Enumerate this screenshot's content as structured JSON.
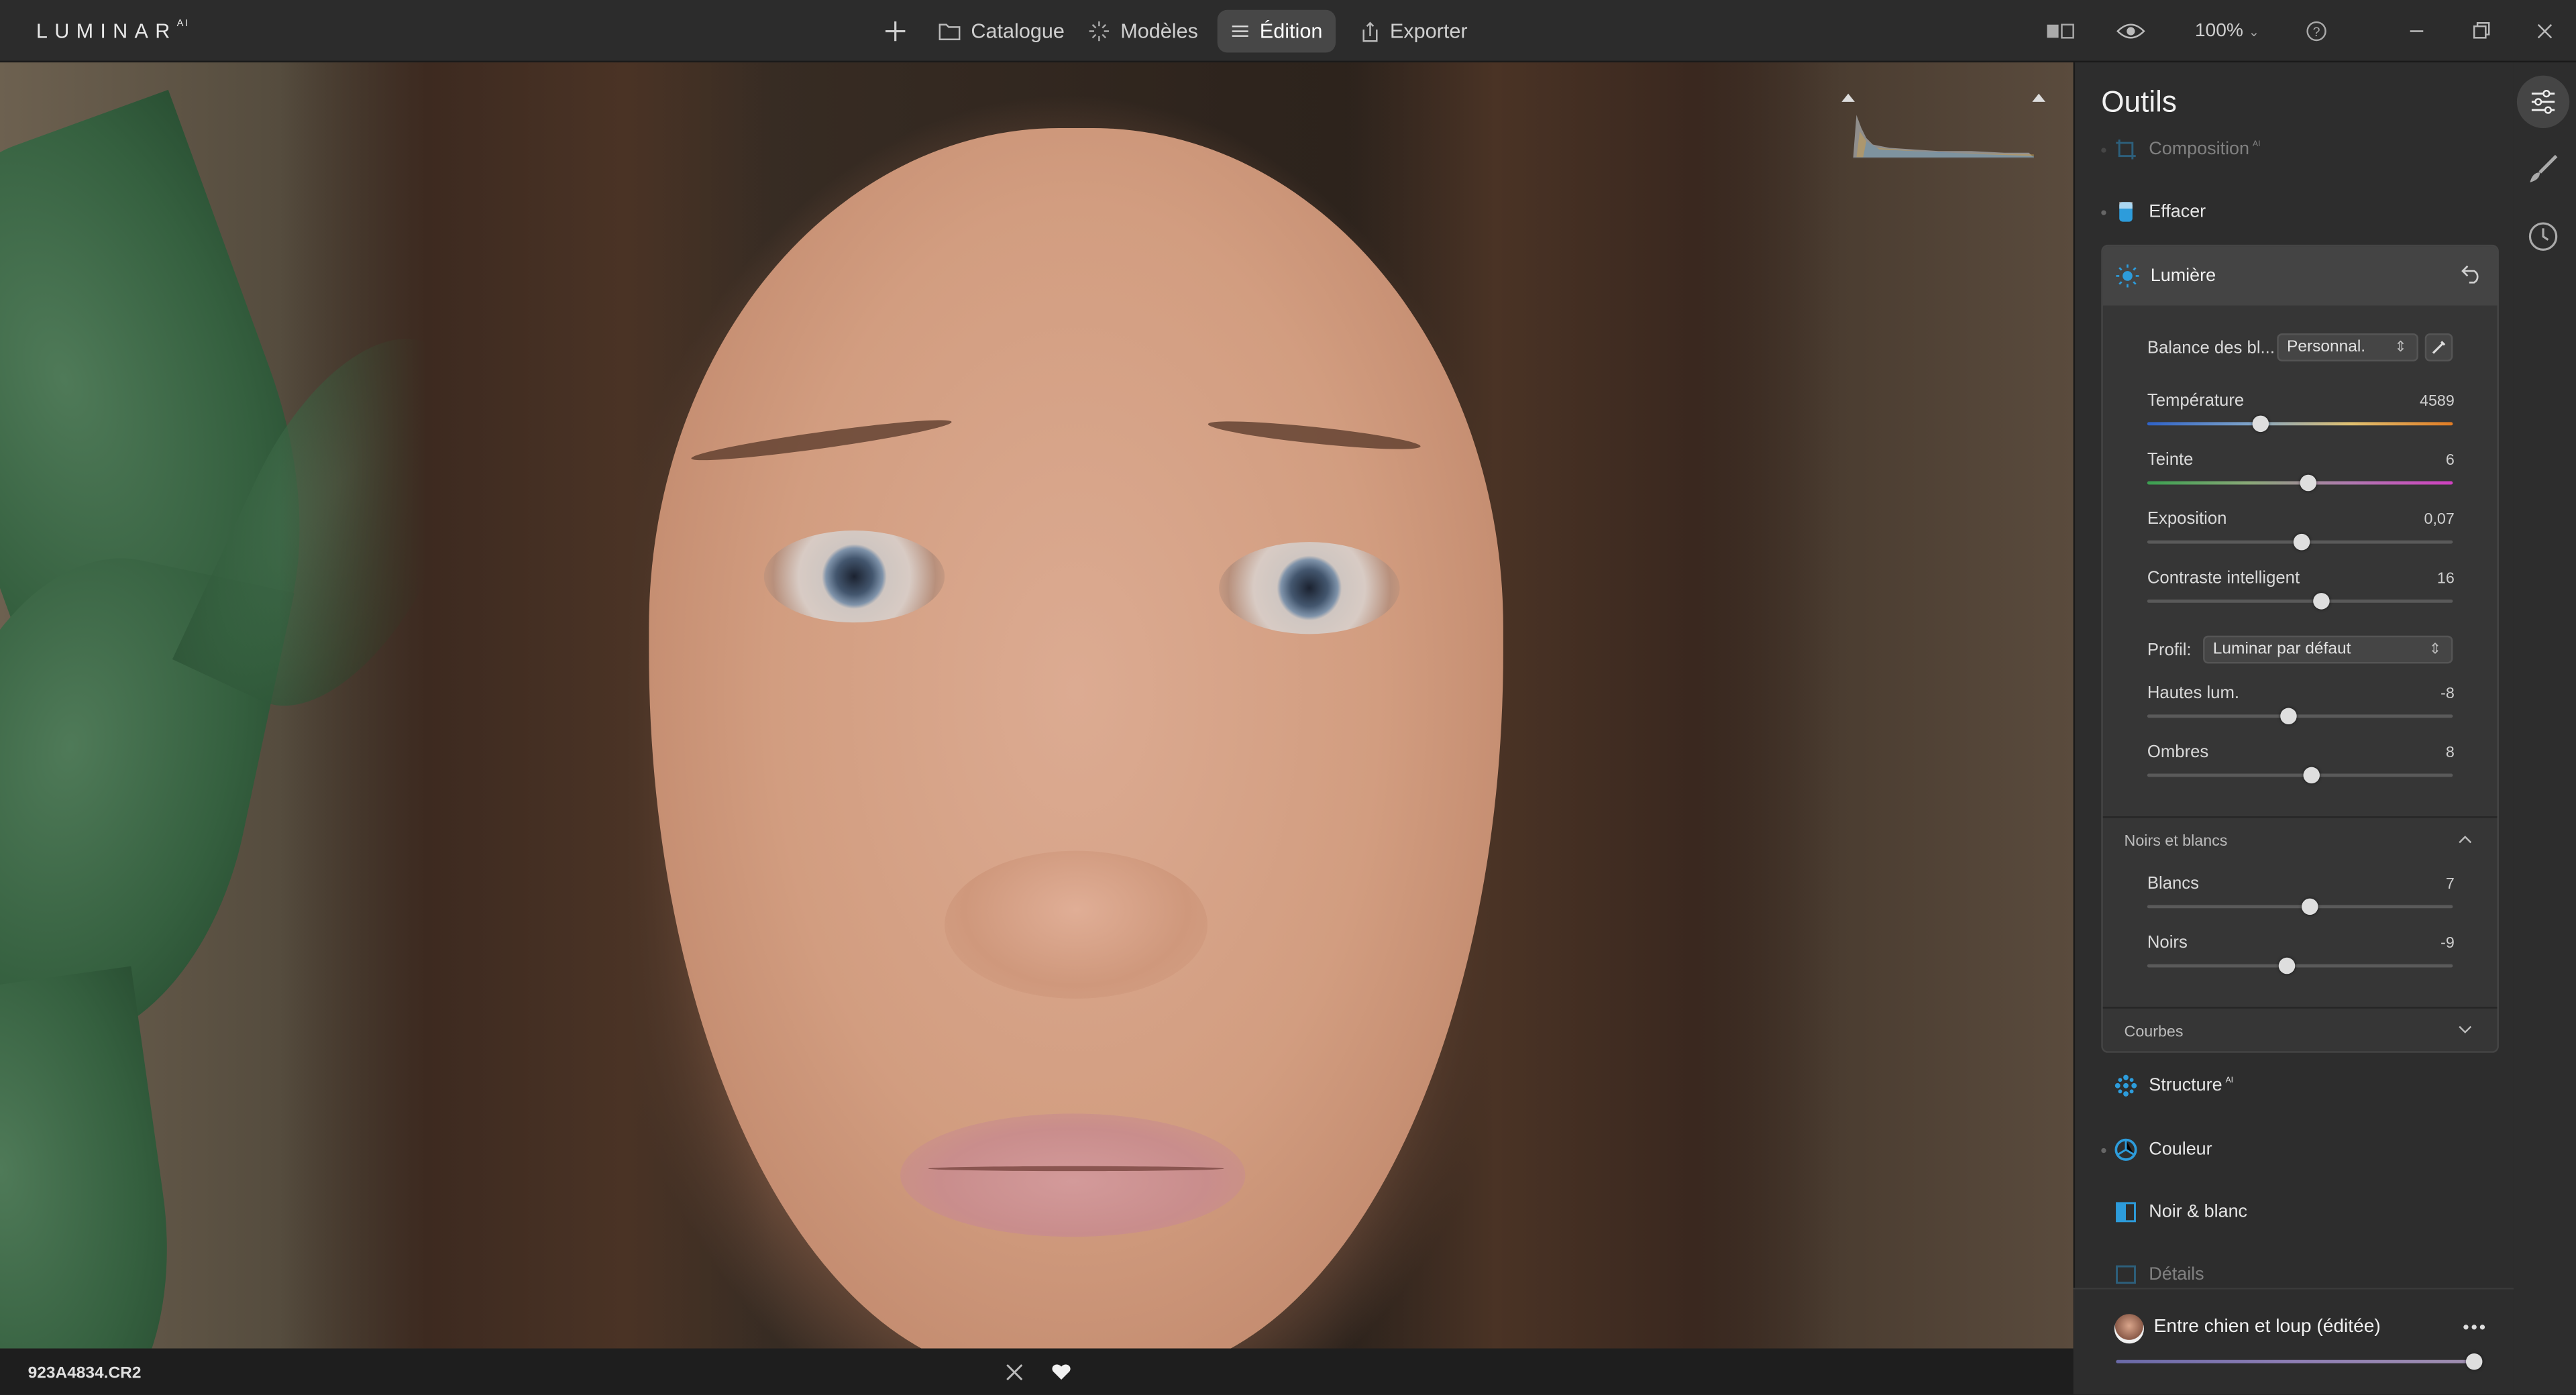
{
  "app": {
    "logo": "LUMINAR",
    "logo_sup": "AI"
  },
  "nav": {
    "add_icon": "plus-icon",
    "catalogue": "Catalogue",
    "modeles": "Modèles",
    "edition": "Édition",
    "exporter": "Exporter"
  },
  "toolbar": {
    "zoom": "100%"
  },
  "photo": {
    "filename": "923A4834.CR2"
  },
  "panel": {
    "title": "Outils",
    "tools_above": [
      {
        "label": "Composition",
        "ai": "AI"
      },
      {
        "label": "Effacer"
      }
    ],
    "lumiere": {
      "title": "Lumière",
      "balance_label": "Balance des bl...",
      "balance_value": "Personnal.",
      "sliders_top": [
        {
          "label": "Température",
          "value": "4589",
          "pos": 0.37
        },
        {
          "label": "Teinte",
          "value": "6",
          "pos": 0.525
        },
        {
          "label": "Exposition",
          "value": "0,07",
          "pos": 0.505
        },
        {
          "label": "Contraste intelligent",
          "value": "16",
          "pos": 0.57
        }
      ],
      "profil_label": "Profil:",
      "profil_value": "Luminar par défaut",
      "sliders_mid": [
        {
          "label": "Hautes lum.",
          "value": "-8",
          "pos": 0.46
        },
        {
          "label": "Ombres",
          "value": "8",
          "pos": 0.535
        }
      ],
      "noirs_section": "Noirs et blancs",
      "sliders_bw": [
        {
          "label": "Blancs",
          "value": "7",
          "pos": 0.53
        },
        {
          "label": "Noirs",
          "value": "-9",
          "pos": 0.455
        }
      ],
      "courbes_section": "Courbes"
    },
    "tools_below": [
      {
        "label": "Structure",
        "ai": "AI"
      },
      {
        "label": "Couleur"
      },
      {
        "label": "Noir & blanc"
      },
      {
        "label": "Détails"
      }
    ]
  },
  "preset": {
    "name": "Entre chien et loup (éditée)",
    "amount": 1.0
  },
  "colors": {
    "accent": "#2d9cdb",
    "panel": "#2d2d2d",
    "topbar": "#2c2c2c"
  }
}
